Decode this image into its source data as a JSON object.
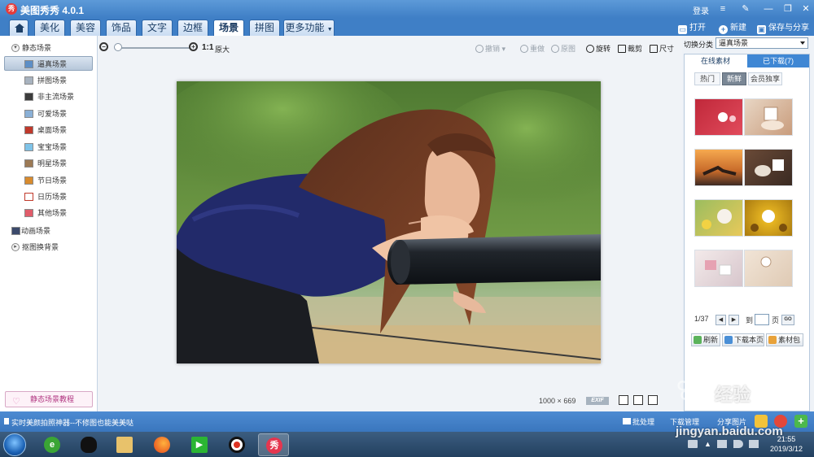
{
  "titlebar": {
    "app_title": "美图秀秀 4.0.1",
    "logo_text": "秀",
    "login": "登录"
  },
  "menu": {
    "tabs": [
      {
        "label": "美化"
      },
      {
        "label": "美容"
      },
      {
        "label": "饰品"
      },
      {
        "label": "文字"
      },
      {
        "label": "边框"
      },
      {
        "label": "场景",
        "active": true
      },
      {
        "label": "拼图"
      },
      {
        "label": "更多功能"
      }
    ],
    "open": "打开",
    "new": "新建",
    "save_share": "保存与分享"
  },
  "left_panel": {
    "static_scene": "静态场景",
    "items": [
      "逼真场景",
      "拼图场景",
      "非主流场景",
      "可爱场景",
      "桌面场景",
      "宝宝场景",
      "明星场景",
      "节日场景",
      "日历场景",
      "其他场景"
    ],
    "selected_item": "逼真场景",
    "animated_scene": "动画场景",
    "cutout_scene": "抠图换背景",
    "tutorial": "静态场景教程"
  },
  "canvas": {
    "zoom_ratio": "1:1",
    "zoom_original": "原大",
    "tools": {
      "undo": "撤销",
      "redo": "重做",
      "original": "原图",
      "rotate": "旋转",
      "crop": "裁剪",
      "size": "尺寸"
    },
    "image_width": "1000",
    "image_times": "×",
    "image_height": "669",
    "exif": "EXIF"
  },
  "right_panel": {
    "category_label": "切换分类",
    "category_value": "逼真场景",
    "tab_online": "在线素材",
    "tab_downloaded": "已下载(7)",
    "subtabs": [
      "热门",
      "新鲜",
      "会员独享"
    ],
    "active_subtab": "新鲜",
    "page": "1/37",
    "goto": "到",
    "page_unit": "页",
    "go": "GO",
    "refresh": "刷新",
    "download_page": "下载本页",
    "material_pack": "素材包"
  },
  "statusbar": {
    "message": "实时美颜拍照神器--不修图也能美美哒",
    "batch": "批处理",
    "download_mgr": "下载管理",
    "share": "分享图片"
  },
  "taskbar": {
    "time": "21:55",
    "date": "2019/3/12"
  },
  "watermark": {
    "line1": "经验",
    "line2": "jingyan.baidu.com"
  },
  "colors": {
    "brand_blue": "#3f7fc6",
    "accent_red": "#e53b3b"
  }
}
